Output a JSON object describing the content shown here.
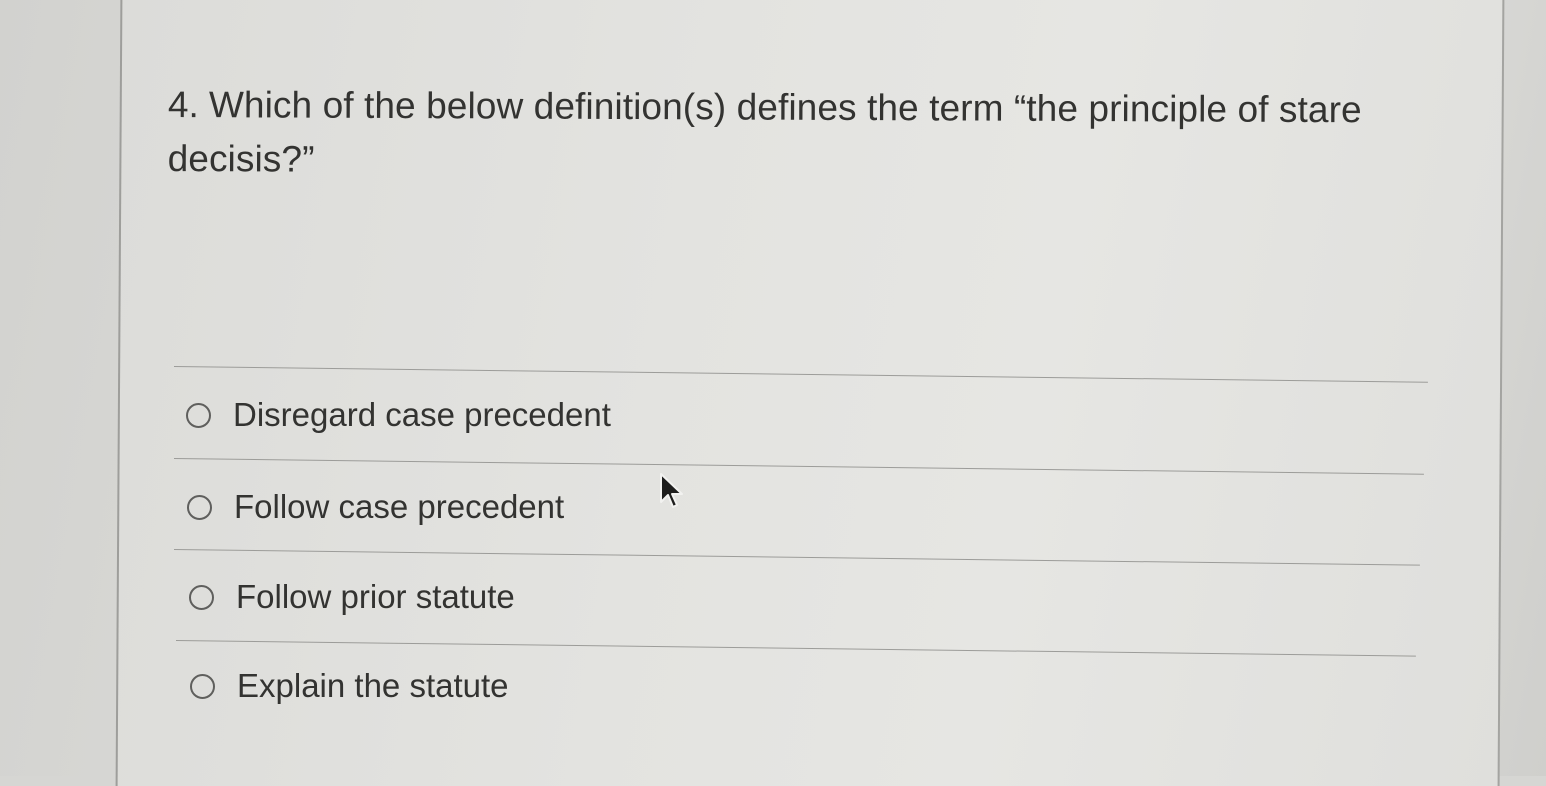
{
  "question": {
    "number": "4.",
    "text": "Which of the below definition(s) defines the term “the principle of stare decisis?”"
  },
  "options": [
    {
      "label": "Disregard case precedent",
      "selected": false
    },
    {
      "label": "Follow case precedent",
      "selected": false
    },
    {
      "label": "Follow prior statute",
      "selected": false
    },
    {
      "label": "Explain the statute",
      "selected": false
    }
  ],
  "colors": {
    "text": "#333331",
    "divider": "#9c9c99",
    "radio_border": "#5f5f5d"
  },
  "icons": {
    "cursor": "mouse-pointer-icon",
    "radio": "radio-button-icon"
  }
}
